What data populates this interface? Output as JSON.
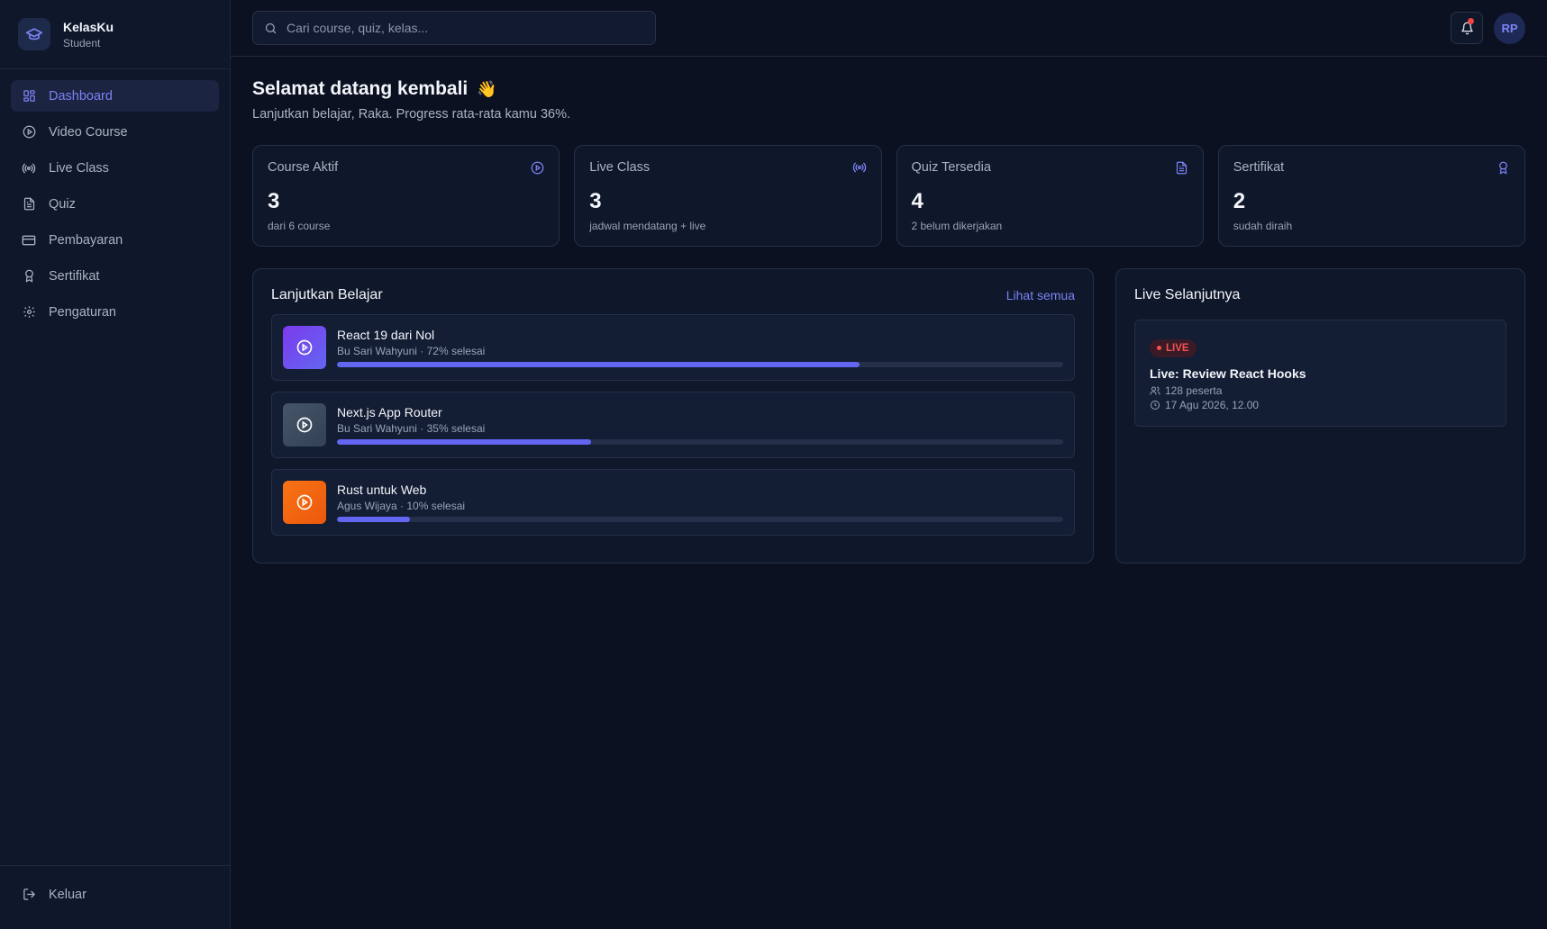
{
  "brand": {
    "name": "KelasKu",
    "role": "Student"
  },
  "sidebar": {
    "items": [
      {
        "label": "Dashboard",
        "icon": "grid-icon",
        "active": true
      },
      {
        "label": "Video Course",
        "icon": "play-circle-icon"
      },
      {
        "label": "Live Class",
        "icon": "broadcast-icon"
      },
      {
        "label": "Quiz",
        "icon": "document-icon"
      },
      {
        "label": "Pembayaran",
        "icon": "credit-card-icon"
      },
      {
        "label": "Sertifikat",
        "icon": "award-icon"
      },
      {
        "label": "Pengaturan",
        "icon": "gear-icon"
      }
    ],
    "logout_label": "Keluar"
  },
  "topbar": {
    "search_placeholder": "Cari course, quiz, kelas...",
    "avatar_initials": "RP"
  },
  "greeting": {
    "title": "Selamat datang kembali",
    "emoji": "👋",
    "subtitle": "Lanjutkan belajar, Raka. Progress rata-rata kamu 36%."
  },
  "stats": [
    {
      "label": "Course Aktif",
      "value": "3",
      "sub": "dari 6 course",
      "icon": "play-circle-icon"
    },
    {
      "label": "Live Class",
      "value": "3",
      "sub": "jadwal mendatang + live",
      "icon": "broadcast-icon"
    },
    {
      "label": "Quiz Tersedia",
      "value": "4",
      "sub": "2 belum dikerjakan",
      "icon": "document-icon"
    },
    {
      "label": "Sertifikat",
      "value": "2",
      "sub": "sudah diraih",
      "icon": "award-icon"
    }
  ],
  "continue": {
    "title": "Lanjutkan Belajar",
    "see_all": "Lihat semua",
    "courses": [
      {
        "title": "React 19 dari Nol",
        "meta": "Bu Sari Wahyuni · 72% selesai",
        "progress": 0.72,
        "color_from": "#7c3aed",
        "color_to": "#6366f1"
      },
      {
        "title": "Next.js App Router",
        "meta": "Bu Sari Wahyuni · 35% selesai",
        "progress": 0.35,
        "color_from": "#475569",
        "color_to": "#334155"
      },
      {
        "title": "Rust untuk Web",
        "meta": "Agus Wijaya · 10% selesai",
        "progress": 0.1,
        "color_from": "#f97316",
        "color_to": "#ea580c"
      }
    ]
  },
  "live": {
    "title": "Live Selanjutnya",
    "badge": "LIVE",
    "session_title": "Live: Review React Hooks",
    "participants": "128 peserta",
    "datetime": "17 Agu 2026, 12.00"
  },
  "colors": {
    "accent": "#6366f1",
    "live_red": "#f05252",
    "notification_dot": "#ef4444"
  }
}
